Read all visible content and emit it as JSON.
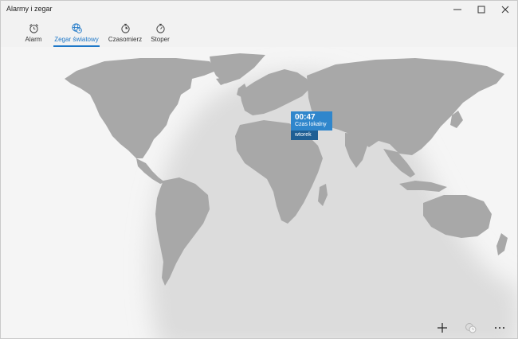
{
  "window": {
    "title": "Alarmy i zegar"
  },
  "tabs": [
    {
      "label": "Alarm",
      "icon": "alarm-clock-icon",
      "active": false
    },
    {
      "label": "Zegar światowy",
      "icon": "world-clock-icon",
      "active": true
    },
    {
      "label": "Czasomierz",
      "icon": "timer-icon",
      "active": false
    },
    {
      "label": "Stoper",
      "icon": "stopwatch-icon",
      "active": false
    }
  ],
  "clock": {
    "time": "00:47",
    "label": "Czas lokalny",
    "day": "wtorek"
  },
  "bottom_bar": {
    "add": "add-icon",
    "compare": "compare-clocks-icon",
    "more": "more-icon"
  },
  "colors": {
    "accent": "#1e78c8",
    "callout": "#2f86cc",
    "callout_day": "#1f5f94",
    "land": "#a6a6a6"
  }
}
